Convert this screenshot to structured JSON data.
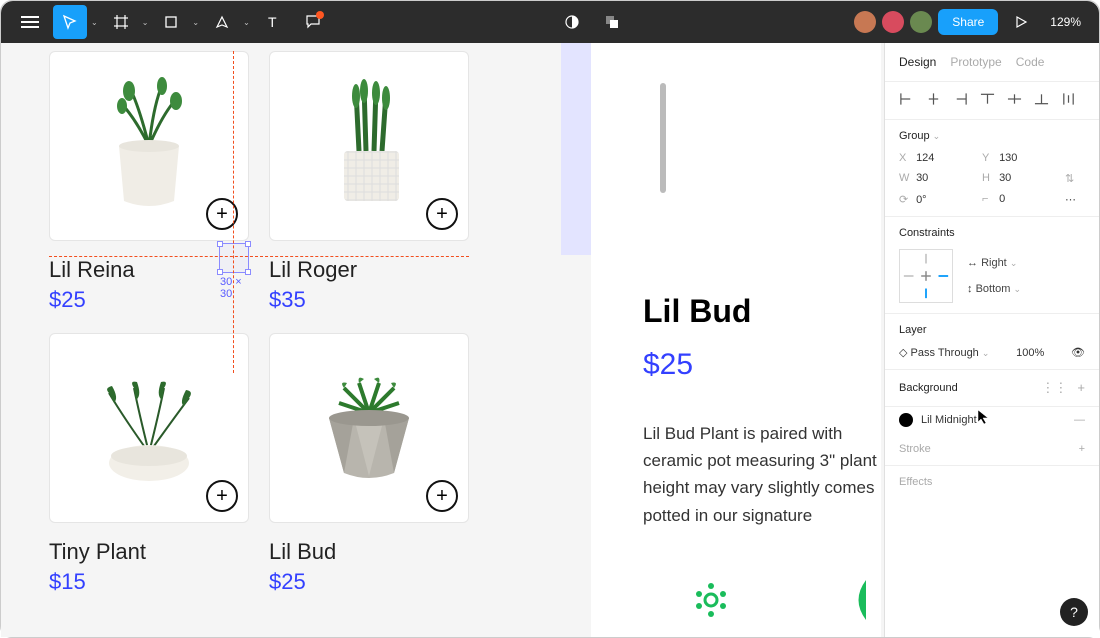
{
  "toolbar": {
    "share_label": "Share",
    "zoom": "129%"
  },
  "avatars": [
    "#c77853",
    "#d84b5e",
    "#6a8950"
  ],
  "products": [
    {
      "name": "Lil Reina",
      "price": "$25"
    },
    {
      "name": "Lil Roger",
      "price": "$35"
    },
    {
      "name": "Tiny Plant",
      "price": "$15"
    },
    {
      "name": "Lil Bud",
      "price": "$25"
    }
  ],
  "selection_dims": "30 × 30",
  "detail": {
    "title": "Lil Bud",
    "price": "$25",
    "description": "Lil Bud Plant is paired with ceramic pot measuring 3\" plant height may vary slightly comes potted in our signature"
  },
  "panel": {
    "tabs": [
      "Design",
      "Prototype",
      "Code"
    ],
    "group_label": "Group",
    "props": {
      "x": "124",
      "y": "130",
      "w": "30",
      "h": "30",
      "rot": "0°",
      "radius": "0"
    },
    "constraints_label": "Constraints",
    "constraint_h": "Right",
    "constraint_v": "Bottom",
    "layer_label": "Layer",
    "blend_mode": "Pass Through",
    "opacity": "100%",
    "background_label": "Background",
    "bg_color_name": "Lil Midnight",
    "stroke_label": "Stroke",
    "effects_label": "Effects"
  },
  "cursor_label": "Lil Midnight"
}
